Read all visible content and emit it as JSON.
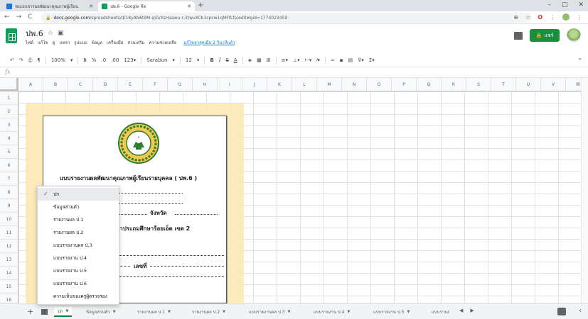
{
  "browser": {
    "tabs": [
      {
        "title": "ชมเอกสารผลพัฒนาคุณภาพผู้เรียน",
        "favicon_color": "#1a73e8"
      },
      {
        "title": "ปพ.6 - Google ชีต",
        "favicon_color": "#0f9d58"
      }
    ],
    "url_host": "docs.google.com",
    "url_path": "/spreadsheets/d/18yAN6t9M-qiG/XsHaawu-r-3twuXCb1cpcw1qMFfLfa/edit#gid=1774023459",
    "window_controls": [
      "–",
      "▢",
      "✕"
    ]
  },
  "doc": {
    "title": "ปพ.6",
    "menu": [
      "ไฟล์",
      "แก้ไข",
      "ดู",
      "แทรก",
      "รูปแบบ",
      "ข้อมูล",
      "เครื่องมือ",
      "ส่วนเสริม",
      "ความช่วยเหลือ"
    ],
    "last_edit": "แก้ไขล่าสุดเมื่อ 2 วินาทีแล้ว",
    "share_label": "แชร์"
  },
  "toolbar": {
    "zoom": "100%",
    "currency": "฿",
    "percent": "%",
    "dec_less": ".0",
    "dec_more": ".00",
    "format_more": "123▾",
    "font": "Sarabun",
    "font_size": "12",
    "bold": "B",
    "italic": "I",
    "strike": "S",
    "text_color": "A"
  },
  "grid": {
    "columns": [
      "A",
      "B",
      "C",
      "D",
      "E",
      "F",
      "G",
      "H",
      "I",
      "J",
      "K",
      "L",
      "M",
      "N",
      "O",
      "P",
      "Q",
      "R",
      "S",
      "T",
      "U",
      "V",
      "W"
    ],
    "rows": [
      "1",
      "2",
      "3",
      "4",
      "5",
      "6",
      "7",
      "8",
      "9",
      "10",
      "11",
      "12",
      "13",
      "14",
      "15",
      "16"
    ]
  },
  "document": {
    "heading": "แบบรายงานผลพัฒนาคุณภาพผู้เรียนรายบุคคล ( ปพ.6 )",
    "school_fragment": "ษา",
    "province_label": "จังหวัด",
    "area_label": "ศึกษาประถมศึกษาร้อยเอ็ด เขต 2",
    "number_label": "เลขที่"
  },
  "sheet_menu": {
    "items": [
      "ปก",
      "ข้อมูลส่วนตัว",
      "รายงานผล ป.1",
      "รายงานผล ป.2",
      "แบบรายงานผล ป.3",
      "แบบรายงาน ป.4",
      "แบบรายงาน ป.5",
      "แบบรายงาน ป.6",
      "ความเห็นของครูผู้ตรวจรอง"
    ],
    "checked_index": 0
  },
  "sheet_tabs": [
    "ปก",
    "ข้อมูลส่วนตัว",
    "รายงานผล ป.1",
    "รายงานผล ป.2",
    "แบบรายงานผล ป.3",
    "แบบรายงาน ป.4",
    "แบบรายงาน ป.5",
    "แบบรายง"
  ],
  "colors": {
    "accent_green": "#0f9d58",
    "share_green": "#1e8e3e",
    "highlight_yellow": "#fce8b2",
    "seal_green": "#2e7d32",
    "seal_gold": "#f2c94c"
  }
}
